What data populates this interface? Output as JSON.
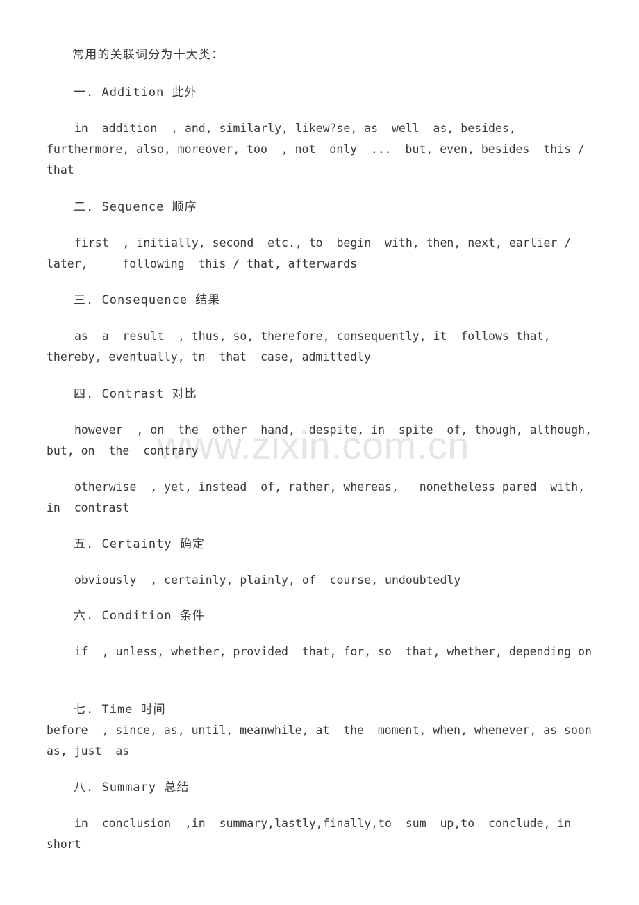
{
  "document": {
    "title": "常用的关联词分为十大类：",
    "watermark": "www.zixin.com.cn",
    "text_color": "#3a3a3a",
    "watermark_color": "#e5e5e5",
    "background_color": "#ffffff",
    "sections": [
      {
        "number": "一.",
        "heading_en": "Addition",
        "heading_zh": "此外",
        "heading": "一.  Addition  此外",
        "body": "in  addition  , and, similarly, likew?se, as  well  as, besides, furthermore, also, moreover, too  , not  only  ...  but, even, besides  this / that"
      },
      {
        "number": "二.",
        "heading_en": "Sequence",
        "heading_zh": "顺序",
        "heading": "二.  Sequence  顺序",
        "body": "first  , initially, second  etc., to  begin  with, then, next, earlier / later,     following  this / that, afterwards"
      },
      {
        "number": "三.",
        "heading_en": "Consequence",
        "heading_zh": "结果",
        "heading": "三.  Consequence  结果",
        "body": "as  a  result  , thus, so, therefore, consequently, it  follows that, thereby, eventually, tn  that  case, admittedly"
      },
      {
        "number": "四.",
        "heading_en": "Contrast",
        "heading_zh": "对比",
        "heading": "四.  Contrast 对比",
        "body": "however  , on  the  other  hand,  despite, in  spite  of, though, although, but, on  the  contrary",
        "body2": "otherwise  , yet, instead  of, rather, whereas,   nonetheless pared  with, in  contrast"
      },
      {
        "number": "五.",
        "heading_en": "Certainty",
        "heading_zh": "确定",
        "heading": "五.  Certainty  确定",
        "body": "obviously  , certainly, plainly, of  course, undoubtedly"
      },
      {
        "number": "六.",
        "heading_en": "Condition",
        "heading_zh": "条件",
        "heading": "六.  Condition  条件",
        "body": "if  , unless, whether, provided  that, for, so  that, whether, depending on"
      },
      {
        "number": "七.",
        "heading_en": "Time",
        "heading_zh": "时间",
        "heading": "七.  Time  时间",
        "body": "before  , since, as, until, meanwhile, at  the  moment, when, whenever, as soon  as, just  as"
      },
      {
        "number": "八.",
        "heading_en": "Summary",
        "heading_zh": "总结",
        "heading": "八.  Summary  总结",
        "body": "in  conclusion  ,in  summary,lastly,finally,to  sum  up,to  conclude, in  short"
      }
    ]
  }
}
